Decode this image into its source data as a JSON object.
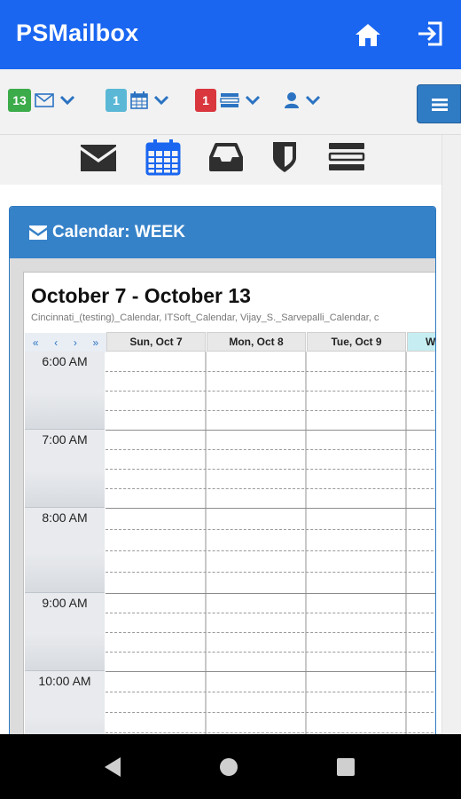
{
  "app": {
    "title": "PSMailbox"
  },
  "toolbar": {
    "mail_count": "13",
    "calendar_count": "1",
    "tasks_count": "1"
  },
  "card": {
    "title": "Calendar: WEEK"
  },
  "calendar": {
    "range_title": "October 7 - October 13",
    "calendars_list": "Cincinnati_(testing)_Calendar, ITSoft_Calendar, Vijay_S._Sarvepalli_Calendar, c",
    "nav": [
      "«",
      "‹",
      "›",
      "»"
    ],
    "days": [
      "Sun, Oct 7",
      "Mon, Oct 8",
      "Tue, Oct 9",
      "W"
    ],
    "times": [
      "6:00 AM",
      "7:00 AM",
      "8:00 AM",
      "9:00 AM",
      "10:00 AM"
    ]
  },
  "colors": {
    "app_bar": "#1a66f0",
    "card_header": "#3682c9",
    "mail_badge": "#3cab4a",
    "calendar_badge": "#5ab8d6",
    "tasks_badge": "#d9363e",
    "today_header": "#c6eef2"
  }
}
